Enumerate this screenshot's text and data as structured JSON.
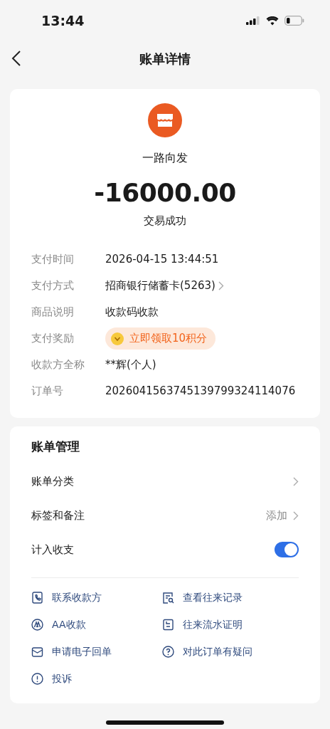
{
  "status_bar": {
    "time": "13:44"
  },
  "header": {
    "title": "账单详情"
  },
  "merchant": {
    "name": "一路向发",
    "amount": "-16000.00",
    "status": "交易成功"
  },
  "details": [
    {
      "label": "支付时间",
      "value": "2026-04-15 13:44:51",
      "kind": "text"
    },
    {
      "label": "支付方式",
      "value": "招商银行储蓄卡(5263)",
      "kind": "link"
    },
    {
      "label": "商品说明",
      "value": "收款码收款",
      "kind": "text"
    },
    {
      "label": "支付奖励",
      "value": "立即领取10积分",
      "kind": "reward"
    },
    {
      "label": "收款方全称",
      "value": "**辉(个人)",
      "kind": "text"
    },
    {
      "label": "订单号",
      "value": "2026041563745139799324114076",
      "kind": "text"
    }
  ],
  "management": {
    "title": "账单管理",
    "rows": [
      {
        "label": "账单分类",
        "kind": "link"
      },
      {
        "label": "标签和备注",
        "kind": "link",
        "value": "添加"
      },
      {
        "label": "计入收支",
        "kind": "toggle",
        "on": true
      }
    ]
  },
  "actions": [
    {
      "label": "联系收款方"
    },
    {
      "label": "查看往来记录"
    },
    {
      "label": "AA收款"
    },
    {
      "label": "往来流水证明"
    },
    {
      "label": "申请电子回单"
    },
    {
      "label": "对此订单有疑问"
    },
    {
      "label": "投诉"
    }
  ]
}
